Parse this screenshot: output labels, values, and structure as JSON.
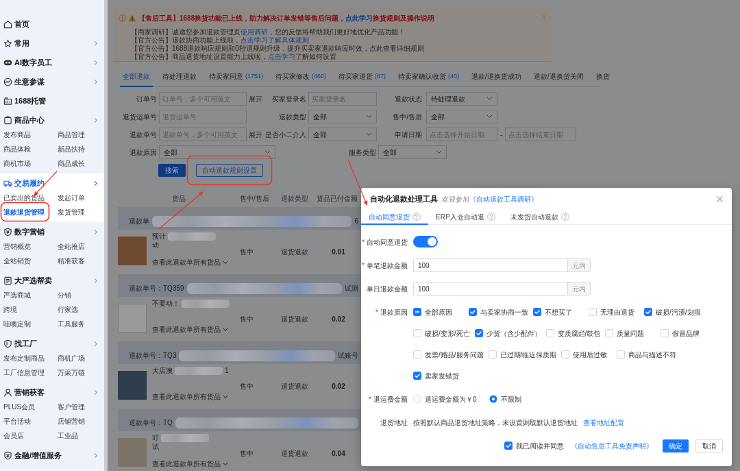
{
  "sidebar": {
    "sections": [
      {
        "title": "首页",
        "expandable": false,
        "selected": false
      },
      {
        "title": "常用",
        "expandable": true,
        "selected": false
      },
      {
        "title": "AI数字员工",
        "expandable": true,
        "selected": false
      },
      {
        "title": "生意参谋",
        "expandable": true,
        "selected": false
      },
      {
        "title": "1688托管",
        "expandable": false,
        "selected": false
      },
      {
        "title": "商品中心",
        "expandable": true,
        "selected": false,
        "items": [
          {
            "label": "发布商品",
            "selected": false
          },
          {
            "label": "商品管理",
            "selected": false
          },
          {
            "label": "商品体检",
            "selected": false
          },
          {
            "label": "新品扶持",
            "selected": false
          },
          {
            "label": "商机市场",
            "selected": false
          },
          {
            "label": "商品成长",
            "selected": false
          }
        ]
      },
      {
        "title": "交易履约",
        "expandable": true,
        "selected": true,
        "items": [
          {
            "label": "已卖出的货品",
            "selected": false
          },
          {
            "label": "发起订单",
            "selected": false
          },
          {
            "label": "退款退货管理",
            "selected": true
          },
          {
            "label": "发货管理",
            "selected": false
          }
        ]
      },
      {
        "title": "数字营销",
        "expandable": true,
        "selected": false,
        "items": [
          {
            "label": "营销概览",
            "selected": false
          },
          {
            "label": "全站推店",
            "selected": false
          },
          {
            "label": "全站销货",
            "selected": false
          },
          {
            "label": "精准获客",
            "selected": false
          }
        ]
      },
      {
        "title": "大严选帮卖",
        "expandable": true,
        "selected": false,
        "items": [
          {
            "label": "严选商城",
            "selected": false
          },
          {
            "label": "分销",
            "selected": false
          },
          {
            "label": "跨境",
            "selected": false
          },
          {
            "label": "行家选",
            "selected": false
          },
          {
            "label": "哇噢定制",
            "selected": false
          },
          {
            "label": "工具服务",
            "selected": false
          }
        ]
      },
      {
        "title": "找工厂",
        "expandable": true,
        "selected": false,
        "items": [
          {
            "label": "发布定制商品",
            "selected": false
          },
          {
            "label": "商机广场",
            "selected": false
          },
          {
            "label": "工厂信息管理",
            "selected": false
          },
          {
            "label": "万采万链",
            "selected": false
          }
        ]
      },
      {
        "title": "营销获客",
        "expandable": true,
        "selected": false,
        "items": [
          {
            "label": "PLUS会员",
            "selected": false
          },
          {
            "label": "客户管理",
            "selected": false
          },
          {
            "label": "平台活动",
            "selected": false
          },
          {
            "label": "店铺营销",
            "selected": false
          },
          {
            "label": "会员店",
            "selected": false
          },
          {
            "label": "工业品",
            "selected": false
          }
        ]
      },
      {
        "title": "金融/增值服务",
        "expandable": true,
        "selected": false
      }
    ]
  },
  "notice": {
    "headline": [
      {
        "text": "【售后工具】1688换货功能已上线，助力解决订单发错等售后问题，",
        "link": false
      },
      {
        "text": "点此学习",
        "link": true
      },
      {
        "text": "换货规则及操作说明",
        "link": false
      }
    ],
    "lines": [
      [
        {
          "text": "【商家调研】诚邀您参加退款管理页",
          "link": false
        },
        {
          "text": "使用调研",
          "link": true
        },
        {
          "text": "，您的反馈将帮助我们更好地优化产品功能！",
          "link": false
        }
      ],
      [
        {
          "text": "【官方公告】退款协商功能上线啦，",
          "link": false
        },
        {
          "text": "点击学习了解具体规则",
          "link": true
        }
      ],
      [
        {
          "text": "【官方公告】1688退款响应规则和0秒退规则升级，提升买卖家退款响应时效，点此查看详细规则",
          "link": false
        }
      ],
      [
        {
          "text": "【官方公告】商品退货地址设置能力上线啦，",
          "link": false
        },
        {
          "text": "点击学习",
          "link": true
        },
        {
          "text": "了解如何设置",
          "link": false
        }
      ]
    ]
  },
  "tabs": [
    {
      "label": "全部退款",
      "selected": true
    },
    {
      "label": "待处理退款",
      "selected": false
    },
    {
      "label": "待卖家同意",
      "count": "(1751)",
      "selected": false
    },
    {
      "label": "待买家修改",
      "count": "(460)",
      "selected": false
    },
    {
      "label": "待买家退货",
      "count": "(87)",
      "selected": false
    },
    {
      "label": "待卖家确认收货",
      "count": "(40)",
      "selected": false
    },
    {
      "label": "退款/退换货成功",
      "selected": false
    },
    {
      "label": "退款/退换货关闭",
      "selected": false
    },
    {
      "label": "换货",
      "selected": false
    }
  ],
  "filters": {
    "rows": [
      [
        {
          "label": "订单号",
          "kind": "input",
          "placeholder": "订单号，多个可用英文",
          "link": "展开"
        },
        {
          "label": "买家登录名",
          "kind": "input",
          "placeholder": "买家登录名"
        },
        {
          "label": "退款状态",
          "kind": "select",
          "value": "待处理退款"
        }
      ],
      [
        {
          "label": "退货运单号",
          "kind": "input",
          "placeholder": "退货运单号"
        },
        {
          "label": "退款类型",
          "kind": "select",
          "value": "全部"
        },
        {
          "label": "售中/售后",
          "kind": "select",
          "value": "全部"
        }
      ],
      [
        {
          "label": "退款单号",
          "kind": "input",
          "placeholder": "退款单号，多个可用英文",
          "link": "展开"
        },
        {
          "label": "是否小二介入",
          "kind": "select",
          "value": "全部"
        },
        {
          "label": "申请日期",
          "kind": "date_range",
          "start_placeholder": "点击选择开始日期",
          "separator": "-",
          "end_placeholder": "点击选择结束日期"
        }
      ],
      [
        {
          "label": "退款原因",
          "kind": "select",
          "value": "全部"
        },
        {
          "label": "服务类型",
          "kind": "select",
          "value": "全部"
        }
      ]
    ],
    "buttons": [
      {
        "label": "搜索",
        "kind": "primary"
      },
      {
        "label": "自动退款规则设置",
        "kind": "outline"
      }
    ]
  },
  "table": {
    "columns": [
      "货品",
      "售中/售后",
      "退款类型",
      "货品已付金额"
    ],
    "groups": [
      {
        "header": "退款单",
        "header_tail": "6",
        "lines": [
          "预计",
          "动"
        ],
        "link": "查看此退款单所有货品",
        "phase": "售中",
        "type": "退货退款",
        "amount": "0.01"
      },
      {
        "header": "退款单号：TQ359",
        "header_tail": "试测",
        "lines": [
          "不要动！"
        ],
        "link": "查看此退款单所有货品",
        "phase": "售中",
        "type": "退货退款",
        "amount": "0.02"
      },
      {
        "header": "退款单号：TQ3",
        "header_tail": "试账号",
        "lines": [
          "大店澳"
        ],
        "line_tail": "1",
        "link": "查看此退款单所有货品",
        "phase": "售中",
        "type": "退货退款",
        "amount": "0.02"
      },
      {
        "header": "退款单号：TQ",
        "lines": [
          "叮",
          "试"
        ],
        "link": "查看此退款单所有货品",
        "phase": "售中",
        "type": "退货退款",
        "amount": "0.04"
      }
    ]
  },
  "modal": {
    "title": "自动化退款处理工具",
    "subtitle": "欢迎参加",
    "subtitle_link": "《自动退款工具调研》",
    "tabs": [
      {
        "label": "自动同意退货",
        "selected": true
      },
      {
        "label": "ERP入仓自动退",
        "selected": false
      },
      {
        "label": "未发货自动退款",
        "selected": false
      }
    ],
    "fields": [
      {
        "kind": "switch",
        "mark": "*",
        "label": "自动同意退货",
        "on": true
      },
      {
        "kind": "amount",
        "mark": "*",
        "label": "单笔退款金额",
        "value": "100",
        "unit": "元内"
      },
      {
        "kind": "amount",
        "label": "单日退款金额",
        "value": "100",
        "unit": "元内"
      },
      {
        "kind": "checkboxes",
        "mark": "*",
        "label": "退款原因",
        "options": [
          {
            "label": "全部原因",
            "checked": false,
            "indeterminate": true
          },
          {
            "label": "与卖家协商一致",
            "checked": true,
            "indeterminate": false
          },
          {
            "label": "不想买了",
            "checked": true,
            "indeterminate": false
          },
          {
            "label": "无理由退货",
            "checked": false,
            "indeterminate": false
          },
          {
            "label": "破损/污渍/划痕",
            "checked": true,
            "indeterminate": false
          },
          {
            "label": "破损/变形/死亡",
            "checked": false,
            "indeterminate": false
          },
          {
            "label": "少货（含少配件）",
            "checked": true,
            "indeterminate": false
          },
          {
            "label": "变质腐烂/鼓包",
            "checked": false,
            "indeterminate": false
          },
          {
            "label": "质量问题",
            "checked": false,
            "indeterminate": false
          },
          {
            "label": "假冒品牌",
            "checked": false,
            "indeterminate": false
          },
          {
            "label": "发票/赠品/服务问题",
            "checked": false,
            "indeterminate": false
          },
          {
            "label": "已过期/临近保质期",
            "checked": false,
            "indeterminate": false
          },
          {
            "label": "使用后过敏",
            "checked": false,
            "indeterminate": false
          },
          {
            "label": "商品与描述不符",
            "checked": false,
            "indeterminate": false
          },
          {
            "label": "卖家发错货",
            "checked": true,
            "indeterminate": false
          }
        ]
      },
      {
        "kind": "radios",
        "mark": "*",
        "label": "退运费金额",
        "options": [
          {
            "label": "退运费金额为￥0",
            "selected": false
          },
          {
            "label": "不限制",
            "selected": true
          }
        ]
      },
      {
        "kind": "address",
        "label": "退货地址",
        "text": "按照默认商品退货地址策略，未设置则取默认退货地址",
        "link": "查看地址配置"
      }
    ],
    "agreement": {
      "checked": true,
      "label": "我已阅读并同意",
      "link": "《自动售后工具免责声明》"
    },
    "buttons": [
      {
        "label": "确定",
        "kind": "primary"
      },
      {
        "label": "取消",
        "kind": "default"
      }
    ]
  }
}
